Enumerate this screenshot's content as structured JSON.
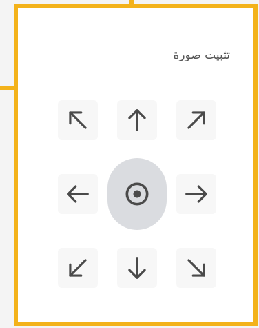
{
  "panel": {
    "title": "تثبيت صورة",
    "accent_color": "#f3b21a",
    "icon_color": "#4a4a4a",
    "selected_bg": "#dadce0"
  },
  "anchors": [
    {
      "id": "top-left",
      "icon": "arrow-up-left-icon",
      "selected": false
    },
    {
      "id": "top",
      "icon": "arrow-up-icon",
      "selected": false
    },
    {
      "id": "top-right",
      "icon": "arrow-up-right-icon",
      "selected": false
    },
    {
      "id": "left",
      "icon": "arrow-left-icon",
      "selected": false
    },
    {
      "id": "center",
      "icon": "target-center-icon",
      "selected": true
    },
    {
      "id": "right",
      "icon": "arrow-right-icon",
      "selected": false
    },
    {
      "id": "bottom-left",
      "icon": "arrow-down-left-icon",
      "selected": false
    },
    {
      "id": "bottom",
      "icon": "arrow-down-icon",
      "selected": false
    },
    {
      "id": "bottom-right",
      "icon": "arrow-down-right-icon",
      "selected": false
    }
  ]
}
